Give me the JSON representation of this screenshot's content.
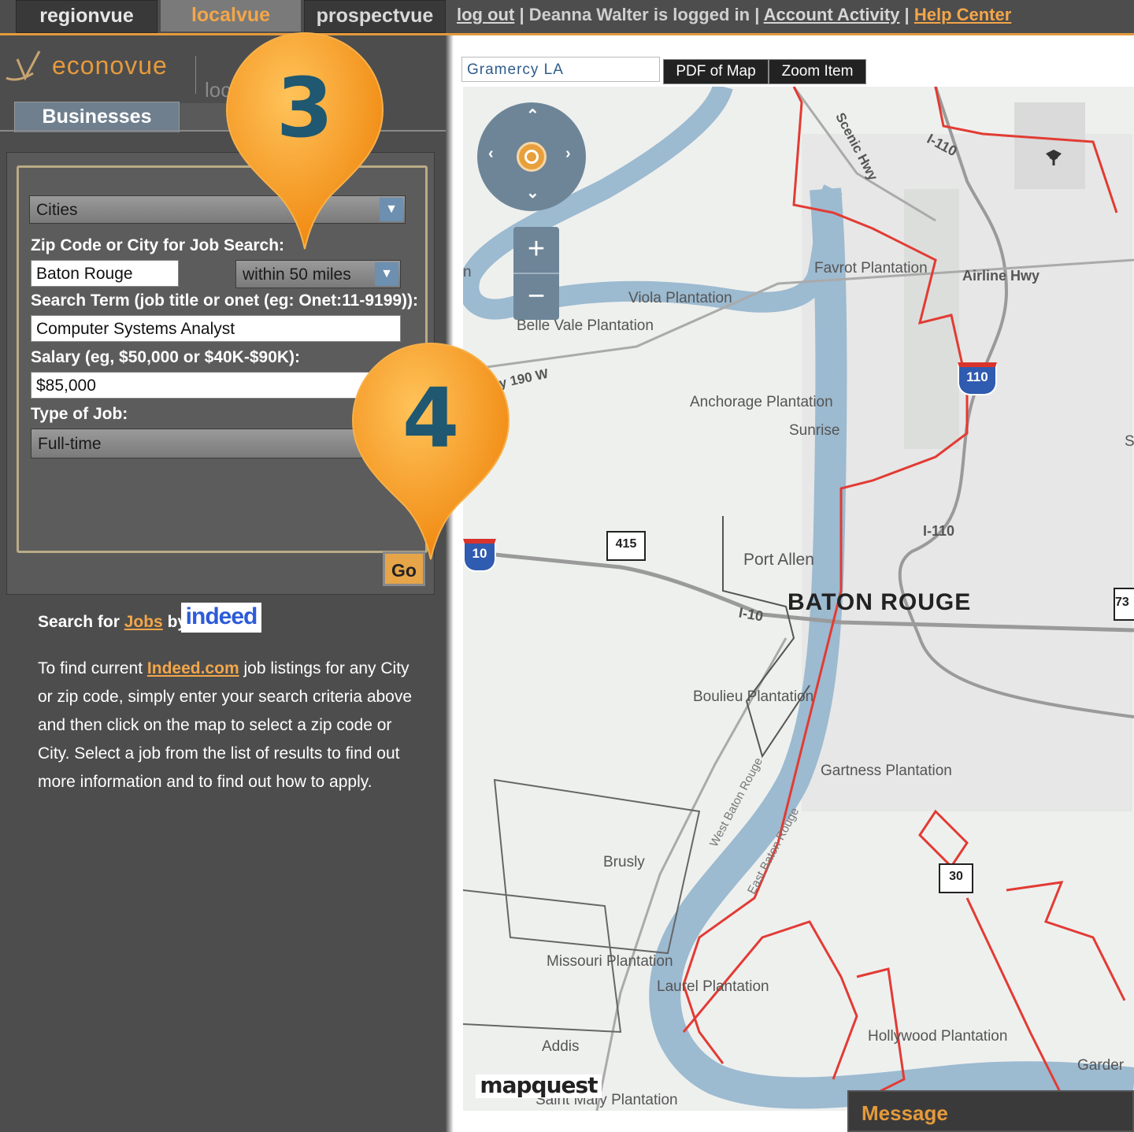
{
  "topnav": {
    "tabs": [
      "regionvue",
      "localvue",
      "prospectvue"
    ],
    "logout": "log out",
    "sep1": "|",
    "user_text": "Deanna Walter is logged in",
    "sep2": "|",
    "account_activity": "Account Activity",
    "sep3": "|",
    "help_center": "Help Center"
  },
  "logo": {
    "brand": "econovue",
    "sub": "loc"
  },
  "subtabs": {
    "businesses": "Businesses"
  },
  "form": {
    "geo_select": "Cities",
    "zip_label": "Zip Code or City for Job Search:",
    "zip_value": "Baton Rouge",
    "radius_select": "within 50 miles",
    "term_label": "Search Term (job title or onet (eg: Onet:11-9199)):",
    "term_value": "Computer Systems Analyst",
    "salary_label": "Salary (eg, $50,000 or $40K-$90K):",
    "salary_value": "$85,000",
    "type_label": "Type of Job:",
    "type_select": "Full-time",
    "go": "Go"
  },
  "jobs": {
    "prefix": "Search for",
    "jobs_link": "Jobs",
    "by": "by",
    "indeed_logo": "indeed",
    "desc_1": "To find current",
    "indeed_link": "Indeed.com",
    "desc_2": "job listings for any City or zip code, simply enter your search criteria above and then click on the map to select a zip code or City. Select a job from the list of results to find out more information and to find out how to apply."
  },
  "map": {
    "location_value": "Gramercy  LA",
    "pdf_button": "PDF of Map",
    "zoom_button": "Zoom Item",
    "zoom_in": "+",
    "zoom_out": "−",
    "labels": {
      "favrot": "Favrot Plantation",
      "airline": "Airline Hwy",
      "viola": "Viola Plantation",
      "belle_vale": "Belle Vale Plantation",
      "hwy190": "ay 190 W",
      "anchorage": "Anchorage Plantation",
      "sunrise": "Sunrise",
      "port_allen": "Port Allen",
      "baton_rouge": "BATON ROUGE",
      "boulieu": "Boulieu Plantation",
      "gartness": "Gartness Plantation",
      "brusly": "Brusly",
      "missouri": "Missouri Plantation",
      "laurel": "Laurel Plantation",
      "hollywood": "Hollywood Plantation",
      "addis": "Addis",
      "saint_mary": "Saint Mary Plantation",
      "garden": "Garder",
      "scenic_hwy": "Scenic Hwy",
      "i110_a": "I-110",
      "i110_b": "I-110",
      "i10": "I-10",
      "west_br": "West Baton Rouge",
      "east_br": "East Baton Rouge",
      "shield_110": "110",
      "shield_10": "10",
      "shield_415": "415",
      "shield_30": "30",
      "shield_73": "73",
      "left_n": "n",
      "right_s": "S"
    },
    "mapquest": "mapquest"
  },
  "message": {
    "title": "Message"
  },
  "callouts": {
    "pin3": "3",
    "pin4": "4"
  }
}
